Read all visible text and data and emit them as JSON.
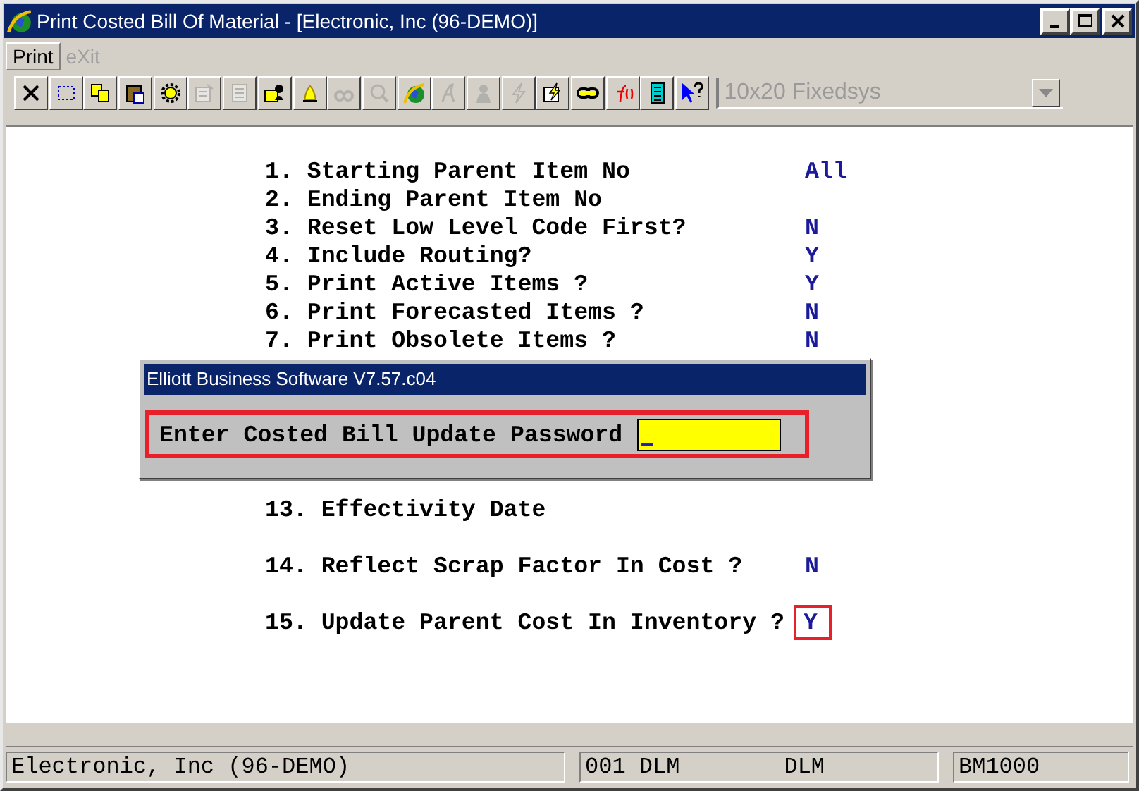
{
  "window": {
    "title": "Print Costed Bill Of Material - [Electronic, Inc (96-DEMO)]"
  },
  "menu": [
    {
      "label": "Print",
      "disabled": false
    },
    {
      "label": "eXit",
      "disabled": true
    }
  ],
  "toolbar": [
    {
      "kind": "close",
      "disabled": false
    },
    {
      "kind": "select",
      "disabled": false
    },
    {
      "kind": "copy",
      "disabled": false
    },
    {
      "kind": "paste",
      "disabled": false
    },
    {
      "kind": "gear",
      "disabled": false
    },
    {
      "kind": "properties",
      "disabled": true
    },
    {
      "kind": "document",
      "disabled": true
    },
    {
      "kind": "person",
      "disabled": false
    },
    {
      "kind": "bell",
      "disabled": false
    },
    {
      "kind": "binoculars",
      "disabled": true
    },
    {
      "kind": "search",
      "disabled": true
    },
    {
      "kind": "globe",
      "disabled": false
    },
    {
      "kind": "script",
      "disabled": true
    },
    {
      "kind": "figure",
      "disabled": true
    },
    {
      "kind": "lightning",
      "disabled": true
    },
    {
      "kind": "lightningdoc",
      "disabled": false
    },
    {
      "kind": "chain",
      "disabled": false
    },
    {
      "kind": "function",
      "disabled": false
    },
    {
      "kind": "calculator",
      "disabled": false
    },
    {
      "kind": "help",
      "disabled": false
    }
  ],
  "font_select": {
    "value": "10x20 Fixedsys",
    "disabled": true
  },
  "form_groups": [
    {
      "items": [
        {
          "label": "1. Starting Parent Item No",
          "value": "All",
          "highlighted": false
        },
        {
          "label": "2. Ending Parent Item No",
          "highlighted": false
        },
        {
          "label": "3. Reset Low Level Code First?",
          "value": "N",
          "highlighted": false
        },
        {
          "label": "4. Include Routing?",
          "value": "Y",
          "highlighted": false
        },
        {
          "label": "5. Print Active Items ?",
          "value": "Y",
          "highlighted": false
        },
        {
          "label": "6. Print Forecasted Items ?",
          "value": "N",
          "highlighted": false
        },
        {
          "label": "7. Print Obsolete Items ?",
          "value": "N",
          "highlighted": false
        }
      ]
    },
    {
      "items": [
        {
          "label": "13. Effectivity Date",
          "highlighted": false
        }
      ]
    },
    {
      "items": [
        {
          "label": "14. Reflect Scrap Factor In Cost ?",
          "value": "N",
          "highlighted": false
        }
      ]
    },
    {
      "items": [
        {
          "label": "15. Update Parent Cost In Inventory ?",
          "value": "Y",
          "highlighted": true
        }
      ]
    }
  ],
  "dialog": {
    "title": "Elliott Business Software V7.57.c04",
    "prompt": "Enter Costed Bill Update Password",
    "highlighted": true
  },
  "status_bar": [
    {
      "texts": [
        "Electronic, Inc (96-DEMO)"
      ]
    },
    {
      "texts": [
        "001 DLM",
        "DLM"
      ]
    },
    {
      "texts": [
        "BM1000"
      ]
    }
  ]
}
